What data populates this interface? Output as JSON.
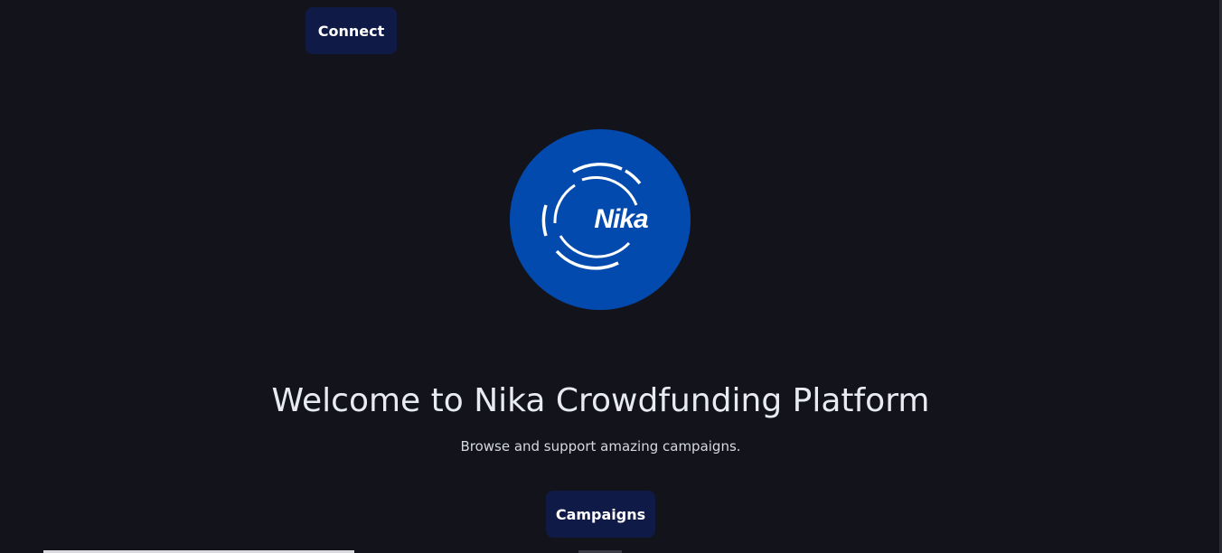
{
  "header": {
    "connect_label": "Connect"
  },
  "logo": {
    "text": "Nika",
    "background_color": "#034aae",
    "icon": "nika-logo"
  },
  "hero": {
    "title": "Welcome to Nika Crowdfunding Platform",
    "subtitle": "Browse and support amazing campaigns.",
    "campaigns_label": "Campaigns"
  },
  "colors": {
    "page_background": "#13141b",
    "button_background": "#101a47",
    "text_primary": "#e9ebf2"
  }
}
